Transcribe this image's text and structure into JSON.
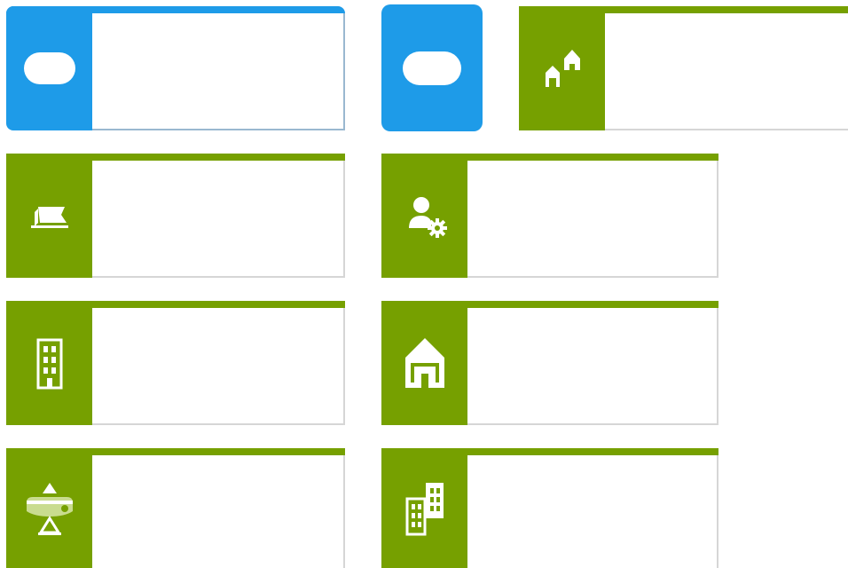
{
  "colors": {
    "blue": "#1e9be8",
    "green": "#76a000",
    "white": "#ffffff",
    "border": "#d6d6d6"
  },
  "tiles": [
    {
      "name": "tile-blue-toggle",
      "color": "blue",
      "icon": "pill-icon",
      "label": ""
    },
    {
      "name": "tile-blue-button",
      "color": "blue",
      "icon": "pill-icon",
      "label": ""
    },
    {
      "name": "tile-neighborhood",
      "color": "green",
      "icon": "houses-icon",
      "label": ""
    },
    {
      "name": "tile-land",
      "color": "green",
      "icon": "land-parcel-icon",
      "label": ""
    },
    {
      "name": "tile-user-settings",
      "color": "green",
      "icon": "user-gear-icon",
      "label": ""
    },
    {
      "name": "tile-building",
      "color": "green",
      "icon": "building-icon",
      "label": ""
    },
    {
      "name": "tile-house",
      "color": "green",
      "icon": "house-icon",
      "label": ""
    },
    {
      "name": "tile-landscape",
      "color": "green",
      "icon": "terrain-icon",
      "label": ""
    },
    {
      "name": "tile-city",
      "color": "green",
      "icon": "city-buildings-icon",
      "label": ""
    }
  ]
}
